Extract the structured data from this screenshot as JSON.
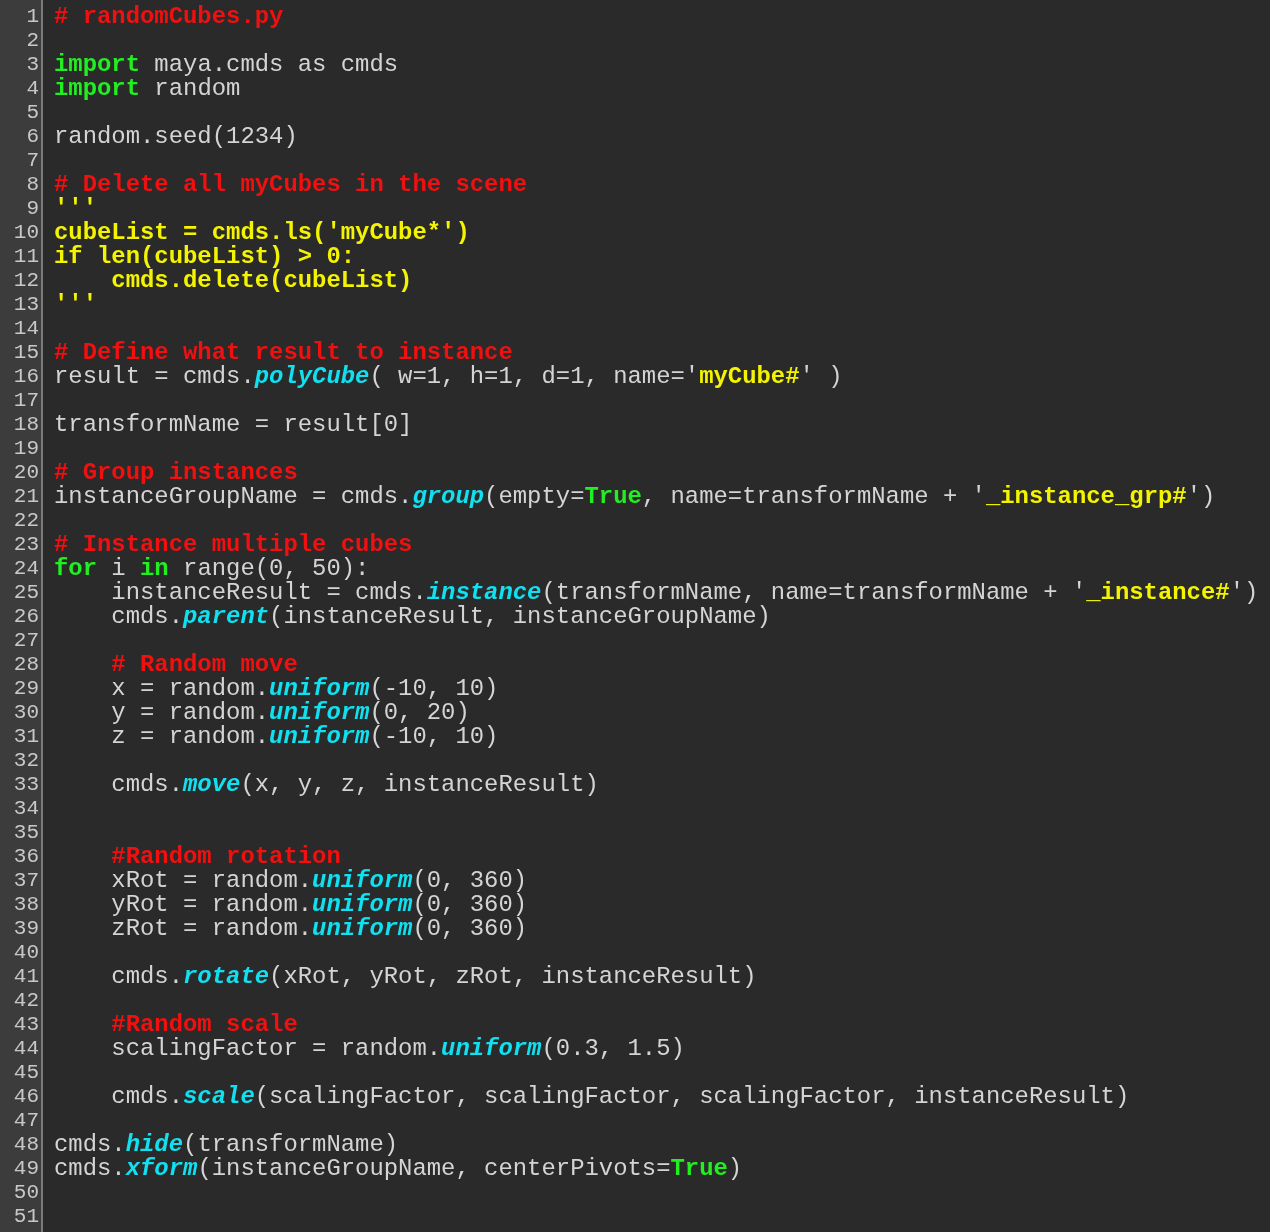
{
  "editor": {
    "lines": [
      {
        "number": "1",
        "tokens": [
          {
            "kind": "comment",
            "text": "# randomCubes.py"
          }
        ]
      },
      {
        "number": "2"
      },
      {
        "number": "3",
        "tokens": [
          {
            "kind": "keyword",
            "text": "import"
          },
          {
            "kind": "plain",
            "text": " maya.cmds as cmds"
          }
        ]
      },
      {
        "number": "4",
        "tokens": [
          {
            "kind": "keyword",
            "text": "import"
          },
          {
            "kind": "plain",
            "text": " random"
          }
        ]
      },
      {
        "number": "5"
      },
      {
        "number": "6",
        "tokens": [
          {
            "kind": "plain",
            "text": "random.seed(1234)"
          }
        ]
      },
      {
        "number": "7"
      },
      {
        "number": "8",
        "tokens": [
          {
            "kind": "comment",
            "text": "# Delete all myCubes in the scene"
          }
        ]
      },
      {
        "number": "9",
        "tokens": [
          {
            "kind": "string",
            "text": "'''"
          }
        ]
      },
      {
        "number": "10",
        "tokens": [
          {
            "kind": "string",
            "text": "cubeList = cmds.ls('myCube*')"
          }
        ]
      },
      {
        "number": "11",
        "tokens": [
          {
            "kind": "string",
            "text": "if len(cubeList) > 0:"
          }
        ]
      },
      {
        "number": "12",
        "tokens": [
          {
            "kind": "string",
            "text": "    cmds.delete(cubeList)"
          }
        ]
      },
      {
        "number": "13",
        "tokens": [
          {
            "kind": "string",
            "text": "'''"
          }
        ]
      },
      {
        "number": "14"
      },
      {
        "number": "15",
        "tokens": [
          {
            "kind": "comment",
            "text": "# Define what result to instance"
          }
        ]
      },
      {
        "number": "16",
        "tokens": [
          {
            "kind": "plain",
            "text": "result = cmds."
          },
          {
            "kind": "func",
            "text": "polyCube"
          },
          {
            "kind": "plain",
            "text": "( w=1, h=1, d=1, name='"
          },
          {
            "kind": "string",
            "text": "myCube#"
          },
          {
            "kind": "plain",
            "text": "' )"
          }
        ]
      },
      {
        "number": "17"
      },
      {
        "number": "18",
        "tokens": [
          {
            "kind": "plain",
            "text": "transformName = result[0]"
          }
        ]
      },
      {
        "number": "19"
      },
      {
        "number": "20",
        "tokens": [
          {
            "kind": "comment",
            "text": "# Group instances"
          }
        ]
      },
      {
        "number": "21",
        "tokens": [
          {
            "kind": "plain",
            "text": "instanceGroupName = cmds."
          },
          {
            "kind": "func",
            "text": "group"
          },
          {
            "kind": "plain",
            "text": "(empty="
          },
          {
            "kind": "keyword",
            "text": "True"
          },
          {
            "kind": "plain",
            "text": ", name=transformName + '"
          },
          {
            "kind": "string",
            "text": "_instance_grp#"
          },
          {
            "kind": "plain",
            "text": "')"
          }
        ]
      },
      {
        "number": "22"
      },
      {
        "number": "23",
        "tokens": [
          {
            "kind": "comment",
            "text": "# Instance multiple cubes"
          }
        ]
      },
      {
        "number": "24",
        "tokens": [
          {
            "kind": "keyword",
            "text": "for"
          },
          {
            "kind": "plain",
            "text": " i "
          },
          {
            "kind": "keyword",
            "text": "in"
          },
          {
            "kind": "plain",
            "text": " range(0, 50):"
          }
        ]
      },
      {
        "number": "25",
        "tokens": [
          {
            "kind": "plain",
            "text": "    instanceResult = cmds."
          },
          {
            "kind": "func",
            "text": "instance"
          },
          {
            "kind": "plain",
            "text": "(transformName, name=transformName + '"
          },
          {
            "kind": "string",
            "text": "_instance#"
          },
          {
            "kind": "plain",
            "text": "')"
          }
        ]
      },
      {
        "number": "26",
        "tokens": [
          {
            "kind": "plain",
            "text": "    cmds."
          },
          {
            "kind": "func",
            "text": "parent"
          },
          {
            "kind": "plain",
            "text": "(instanceResult, instanceGroupName)"
          }
        ]
      },
      {
        "number": "27"
      },
      {
        "number": "28",
        "tokens": [
          {
            "kind": "comment",
            "text": "    # Random move"
          }
        ]
      },
      {
        "number": "29",
        "tokens": [
          {
            "kind": "plain",
            "text": "    x = random."
          },
          {
            "kind": "func",
            "text": "uniform"
          },
          {
            "kind": "plain",
            "text": "(-10, 10)"
          }
        ]
      },
      {
        "number": "30",
        "tokens": [
          {
            "kind": "plain",
            "text": "    y = random."
          },
          {
            "kind": "func",
            "text": "uniform"
          },
          {
            "kind": "plain",
            "text": "(0, 20)"
          }
        ]
      },
      {
        "number": "31",
        "tokens": [
          {
            "kind": "plain",
            "text": "    z = random."
          },
          {
            "kind": "func",
            "text": "uniform"
          },
          {
            "kind": "plain",
            "text": "(-10, 10)"
          }
        ]
      },
      {
        "number": "32"
      },
      {
        "number": "33",
        "tokens": [
          {
            "kind": "plain",
            "text": "    cmds."
          },
          {
            "kind": "func",
            "text": "move"
          },
          {
            "kind": "plain",
            "text": "(x, y, z, instanceResult)"
          }
        ]
      },
      {
        "number": "34"
      },
      {
        "number": "35"
      },
      {
        "number": "36",
        "tokens": [
          {
            "kind": "comment",
            "text": "    #Random rotation"
          }
        ]
      },
      {
        "number": "37",
        "tokens": [
          {
            "kind": "plain",
            "text": "    xRot = random."
          },
          {
            "kind": "func",
            "text": "uniform"
          },
          {
            "kind": "plain",
            "text": "(0, 360)"
          }
        ]
      },
      {
        "number": "38",
        "tokens": [
          {
            "kind": "plain",
            "text": "    yRot = random."
          },
          {
            "kind": "func",
            "text": "uniform"
          },
          {
            "kind": "plain",
            "text": "(0, 360)"
          }
        ]
      },
      {
        "number": "39",
        "tokens": [
          {
            "kind": "plain",
            "text": "    zRot = random."
          },
          {
            "kind": "func",
            "text": "uniform"
          },
          {
            "kind": "plain",
            "text": "(0, 360)"
          }
        ]
      },
      {
        "number": "40"
      },
      {
        "number": "41",
        "tokens": [
          {
            "kind": "plain",
            "text": "    cmds."
          },
          {
            "kind": "func",
            "text": "rotate"
          },
          {
            "kind": "plain",
            "text": "(xRot, yRot, zRot, instanceResult)"
          }
        ]
      },
      {
        "number": "42"
      },
      {
        "number": "43",
        "tokens": [
          {
            "kind": "comment",
            "text": "    #Random scale"
          }
        ]
      },
      {
        "number": "44",
        "tokens": [
          {
            "kind": "plain",
            "text": "    scalingFactor = random."
          },
          {
            "kind": "func",
            "text": "uniform"
          },
          {
            "kind": "plain",
            "text": "(0.3, 1.5)"
          }
        ]
      },
      {
        "number": "45"
      },
      {
        "number": "46",
        "tokens": [
          {
            "kind": "plain",
            "text": "    cmds."
          },
          {
            "kind": "func",
            "text": "scale"
          },
          {
            "kind": "plain",
            "text": "(scalingFactor, scalingFactor, scalingFactor, instanceResult)"
          }
        ]
      },
      {
        "number": "47"
      },
      {
        "number": "48",
        "tokens": [
          {
            "kind": "plain",
            "text": "cmds."
          },
          {
            "kind": "func",
            "text": "hide"
          },
          {
            "kind": "plain",
            "text": "(transformName)"
          }
        ]
      },
      {
        "number": "49",
        "tokens": [
          {
            "kind": "plain",
            "text": "cmds."
          },
          {
            "kind": "func",
            "text": "xform"
          },
          {
            "kind": "plain",
            "text": "(instanceGroupName, centerPivots="
          },
          {
            "kind": "keyword",
            "text": "True"
          },
          {
            "kind": "plain",
            "text": ")"
          }
        ]
      },
      {
        "number": "50"
      },
      {
        "number": "51"
      }
    ]
  }
}
